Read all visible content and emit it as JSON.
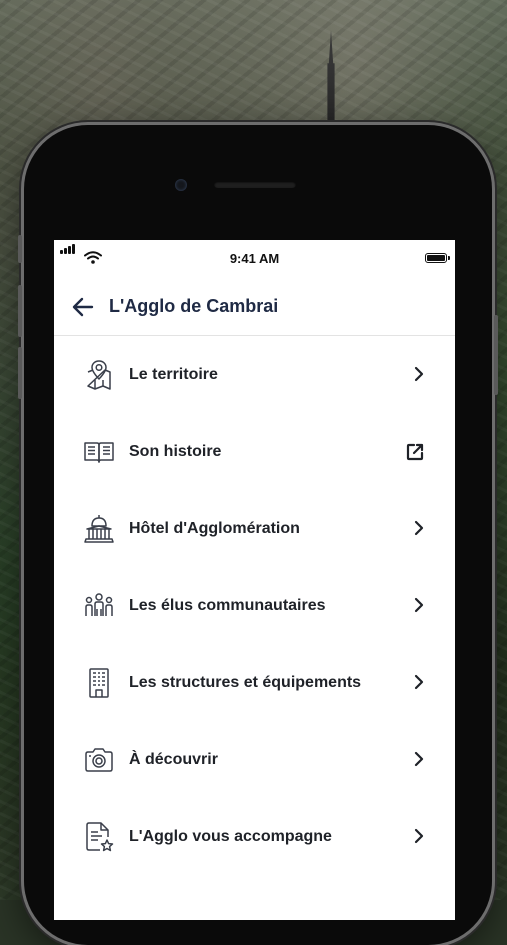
{
  "status_bar": {
    "time": "9:41 AM"
  },
  "header": {
    "title": "L'Agglo de Cambrai"
  },
  "menu": {
    "items": [
      {
        "label": "Le territoire",
        "icon": "map-pin-icon",
        "action": "chevron"
      },
      {
        "label": "Son histoire",
        "icon": "book-icon",
        "action": "external-link"
      },
      {
        "label": "Hôtel d'Agglomération",
        "icon": "building-dome-icon",
        "action": "chevron"
      },
      {
        "label": "Les élus communautaires",
        "icon": "people-group-icon",
        "action": "chevron"
      },
      {
        "label": "Les structures et équipements",
        "icon": "office-building-icon",
        "action": "chevron"
      },
      {
        "label": "À découvrir",
        "icon": "camera-icon",
        "action": "chevron"
      },
      {
        "label": "L'Agglo vous accompagne",
        "icon": "document-star-icon",
        "action": "chevron"
      }
    ]
  },
  "colors": {
    "title": "#1f2a44",
    "text": "#1f2228",
    "icon_stroke": "#3a3f4a"
  }
}
